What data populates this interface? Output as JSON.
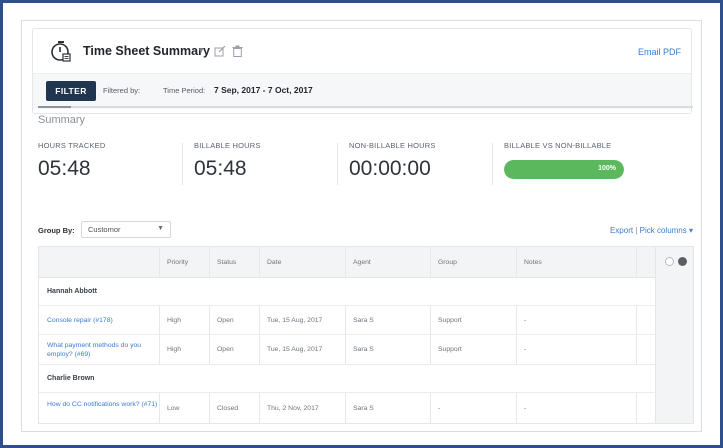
{
  "header": {
    "title": "Time Sheet Summary",
    "email_link": "Email PDF",
    "filter_button": "FILTER",
    "filtered_by": "Filtered by:",
    "period_label": "Time Period:",
    "period_value": "7 Sep, 2017 - 7 Oct, 2017"
  },
  "summary": {
    "title": "Summary",
    "stats": [
      {
        "label": "HOURS TRACKED",
        "value": "05:48"
      },
      {
        "label": "BILLABLE HOURS",
        "value": "05:48"
      },
      {
        "label": "NON-BILLABLE HOURS",
        "value": "00:00:00"
      },
      {
        "label": "BILLABLE VS NON-BILLABLE",
        "percent": 100,
        "percent_text": "100%",
        "color": "#5cb85c"
      }
    ]
  },
  "grouping": {
    "label": "Group By:",
    "selected": "Customor",
    "export": "Export",
    "separator": "|",
    "pick_columns": "Pick columns"
  },
  "table": {
    "columns": [
      "Priority",
      "Status",
      "Date",
      "Agent",
      "Group",
      "Notes"
    ],
    "groups": [
      {
        "name": "Hannah Abbott",
        "rows": [
          {
            "subject": "Console repair (#178)",
            "priority": "High",
            "status": "Open",
            "date": "Tue, 15 Aug, 2017",
            "agent": "Sara S",
            "group": "Support",
            "notes": "-"
          },
          {
            "subject": "What payment methods do you employ? (#69)",
            "priority": "High",
            "status": "Open",
            "date": "Tue, 15 Aug, 2017",
            "agent": "Sara S",
            "group": "Support",
            "notes": "-"
          }
        ]
      },
      {
        "name": "Charlie Brown",
        "rows": [
          {
            "subject": "How do CC notifications work? (#71)",
            "priority": "Low",
            "status": "Closed",
            "date": "Thu, 2 Nov, 2017",
            "agent": "Sara S",
            "group": "-",
            "notes": "-"
          }
        ]
      }
    ]
  },
  "colors": {
    "accent": "#3a7bd5",
    "filter_button": "#1f3550",
    "border": "#2f4e8c"
  }
}
